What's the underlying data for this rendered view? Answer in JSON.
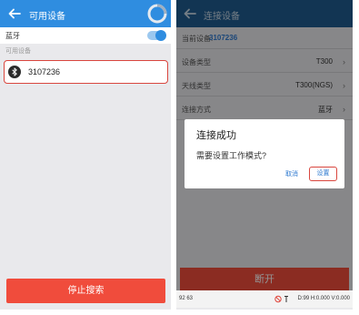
{
  "left": {
    "title": "可用设备",
    "bluetooth_label": "蓝牙",
    "bluetooth_on": true,
    "section_label": "可用设备",
    "devices": [
      {
        "name": "3107236"
      }
    ],
    "stop_search_label": "停止搜索"
  },
  "right": {
    "title": "连接设备",
    "rows": [
      {
        "label": "当前设备:",
        "value": "3107236"
      },
      {
        "label": "设备类型",
        "value": "T300"
      },
      {
        "label": "天线类型",
        "value": "T300(NGS)"
      },
      {
        "label": "连接方式",
        "value": "蓝牙"
      }
    ],
    "connect_label": "断开",
    "status": {
      "left": "92  63",
      "right": "D:99 H:0.000 V:0.000"
    },
    "dialog": {
      "title": "连接成功",
      "message": "需要设置工作模式?",
      "cancel_label": "取消",
      "ok_label": "设置"
    }
  },
  "colors": {
    "appbar_left": "#2f8de0",
    "appbar_right": "#1f5c8f",
    "accent_red": "#f04c3c",
    "highlight_border": "#d9463e",
    "link_blue": "#2f7ad0"
  }
}
